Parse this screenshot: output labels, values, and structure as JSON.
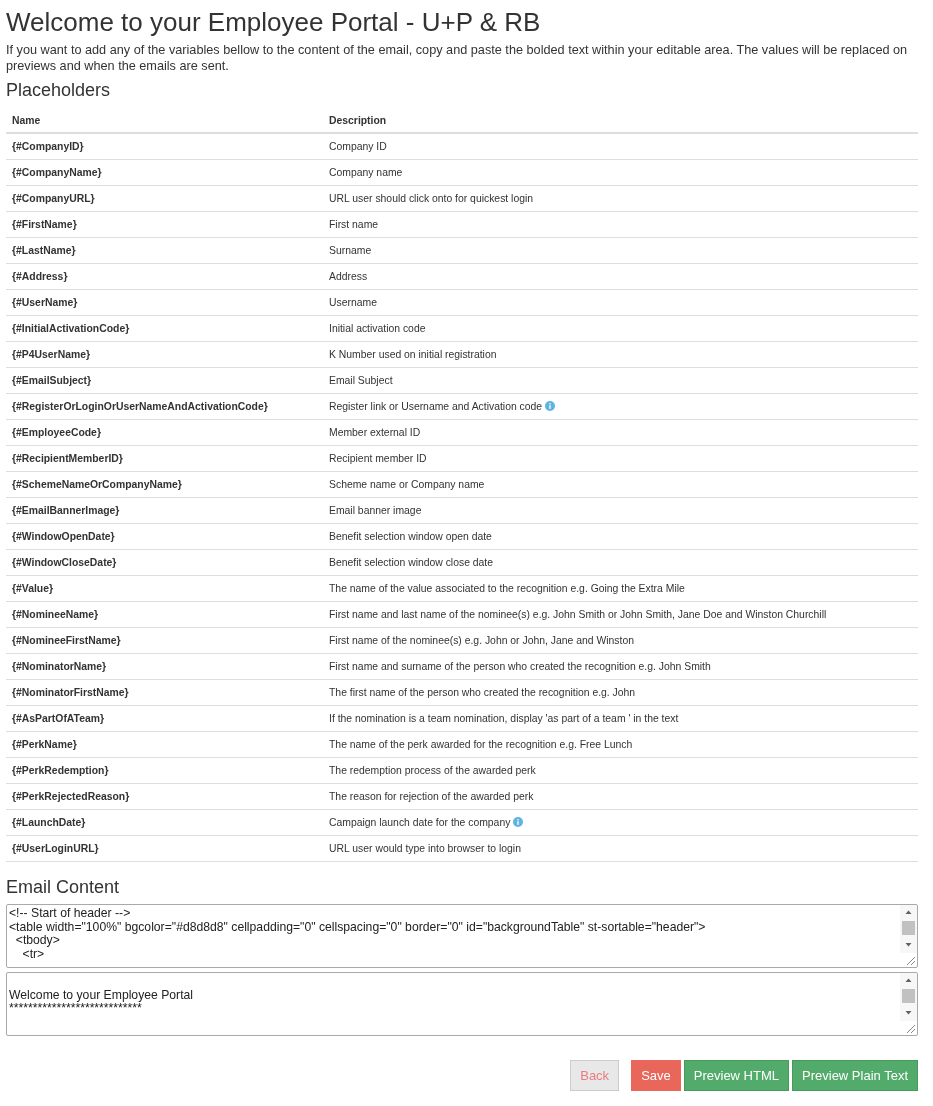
{
  "page": {
    "title": "Welcome to your Employee Portal - U+P & RB",
    "intro": "If you want to add any of the variables bellow to the content of the email, copy and paste the bolded text within your editable area. The values will be replaced on previews and when the emails are sent."
  },
  "placeholders": {
    "heading": "Placeholders",
    "columns": [
      "Name",
      "Description"
    ],
    "rows": [
      {
        "name": "{#CompanyID}",
        "description": "Company ID",
        "info_icon": false
      },
      {
        "name": "{#CompanyName}",
        "description": "Company name",
        "info_icon": false
      },
      {
        "name": "{#CompanyURL}",
        "description": "URL user should click onto for quickest login",
        "info_icon": false
      },
      {
        "name": "{#FirstName}",
        "description": "First name",
        "info_icon": false
      },
      {
        "name": "{#LastName}",
        "description": "Surname",
        "info_icon": false
      },
      {
        "name": "{#Address}",
        "description": "Address",
        "info_icon": false
      },
      {
        "name": "{#UserName}",
        "description": "Username",
        "info_icon": false
      },
      {
        "name": "{#InitialActivationCode}",
        "description": "Initial activation code",
        "info_icon": false
      },
      {
        "name": "{#P4UserName}",
        "description": "K Number used on initial registration",
        "info_icon": false
      },
      {
        "name": "{#EmailSubject}",
        "description": "Email Subject",
        "info_icon": false
      },
      {
        "name": "{#RegisterOrLoginOrUserNameAndActivationCode}",
        "description": "Register link or Username and Activation code",
        "info_icon": true
      },
      {
        "name": "{#EmployeeCode}",
        "description": "Member external ID",
        "info_icon": false
      },
      {
        "name": "{#RecipientMemberID}",
        "description": "Recipient member ID",
        "info_icon": false
      },
      {
        "name": "{#SchemeNameOrCompanyName}",
        "description": "Scheme name or Company name",
        "info_icon": false
      },
      {
        "name": "{#EmailBannerImage}",
        "description": "Email banner image",
        "info_icon": false
      },
      {
        "name": "{#WindowOpenDate}",
        "description": "Benefit selection window open date",
        "info_icon": false
      },
      {
        "name": "{#WindowCloseDate}",
        "description": "Benefit selection window close date",
        "info_icon": false
      },
      {
        "name": "{#Value}",
        "description": "The name of the value associated to the recognition e.g. Going the Extra Mile",
        "info_icon": false
      },
      {
        "name": "{#NomineeName}",
        "description": "First name and last name of the nominee(s) e.g. John Smith or John Smith, Jane Doe and Winston Churchill",
        "info_icon": false
      },
      {
        "name": "{#NomineeFirstName}",
        "description": "First name of the nominee(s) e.g. John or John, Jane and Winston",
        "info_icon": false
      },
      {
        "name": "{#NominatorName}",
        "description": "First name and surname of the person who created the recognition e.g. John Smith",
        "info_icon": false
      },
      {
        "name": "{#NominatorFirstName}",
        "description": "The first name of the person who created the recognition e.g. John",
        "info_icon": false
      },
      {
        "name": "{#AsPartOfATeam}",
        "description": "If the nomination is a team nomination, display 'as part of a team ' in the text",
        "info_icon": false
      },
      {
        "name": "{#PerkName}",
        "description": "The name of the perk awarded for the recognition e.g. Free Lunch",
        "info_icon": false
      },
      {
        "name": "{#PerkRedemption}",
        "description": "The redemption process of the awarded perk",
        "info_icon": false
      },
      {
        "name": "{#PerkRejectedReason}",
        "description": "The reason for rejection of the awarded perk",
        "info_icon": false
      },
      {
        "name": "{#LaunchDate}",
        "description": "Campaign launch date for the company",
        "info_icon": true
      },
      {
        "name": "{#UserLoginURL}",
        "description": "URL user would type into browser to login",
        "info_icon": false
      }
    ]
  },
  "email_content": {
    "heading": "Email Content",
    "fields": [
      {
        "value": "<!-- Start of header -->\n<table width=\"100%\" bgcolor=\"#d8d8d8\" cellpadding=\"0\" cellspacing=\"0\" border=\"0\" id=\"backgroundTable\" st-sortable=\"header\">\n  <tbody>\n    <tr>"
      },
      {
        "value": "\nWelcome to your Employee Portal\n****************************"
      }
    ]
  },
  "buttons": [
    {
      "label": "Back",
      "kind": "neutral"
    },
    {
      "label": "Save",
      "kind": "danger"
    },
    {
      "label": "Preview HTML",
      "kind": "success"
    },
    {
      "label": "Preview Plain Text",
      "kind": "success"
    }
  ]
}
